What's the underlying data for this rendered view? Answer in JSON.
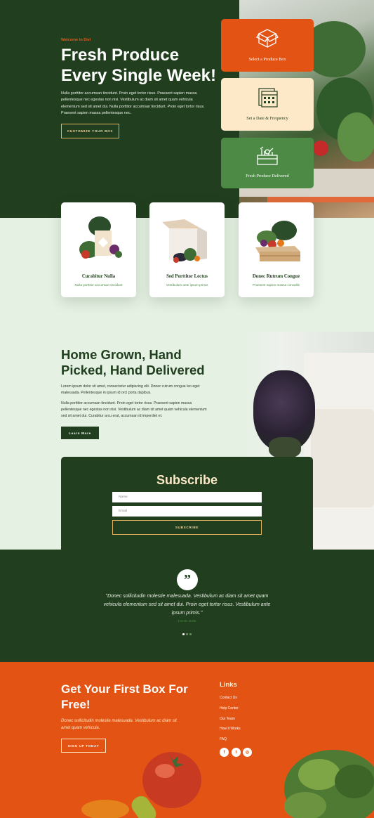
{
  "hero": {
    "eyebrow": "Welcome to Divi",
    "title": "Fresh Produce Every Single Week!",
    "text": "Nulla porttitor accumsan tincidunt. Proin eget tortor risus. Praesent sapien massa pellentesque nec egestas non nisi. Vestibulum ac diam sit amet quam vehicula elementum sed sit amet dui. Nulla porttitor accumsan tincidunt. Proin eget tortor risus. Praesent sapien massa pellentesque nec.",
    "button": "Customize Your Box"
  },
  "steps": [
    {
      "label": "Select a Produce Box",
      "icon": "box-icon"
    },
    {
      "label": "Set a Date & Frequency",
      "icon": "calendar-icon"
    },
    {
      "label": "Fresh Produce Delivered",
      "icon": "basket-icon"
    }
  ],
  "products": [
    {
      "name": "Curabitur Nulla",
      "desc": "Nulla porttitor accumsan tincidunt"
    },
    {
      "name": "Sed Porttitor Lectus",
      "desc": "Vestibulum ante ipsum primis"
    },
    {
      "name": "Donec Rutrum Congue",
      "desc": "Praesent sapien massa convallis"
    }
  ],
  "about": {
    "title": "Home Grown, Hand Picked, Hand Delivered",
    "p1": "Lorem ipsum dolor sit amet, consectetur adipiscing elit. Donec rutrum congue leo eget malesuada. Pellentesque in ipsum id orci porta dapibus.",
    "p2": "Nulla porttitor accumsan tincidunt. Proin eget tortor risus. Praesent sapien massa pellentesque nec egestas non nisi. Vestibulum ac diam sit amet quam vehicula elementum sed sit amet dui. Curabitur arcu erat, accumsan id imperdiet et.",
    "button": "Learn More"
  },
  "subscribe": {
    "title": "Subscribe",
    "name_placeholder": "Name",
    "email_placeholder": "Email",
    "button": "Subscribe"
  },
  "testimonial": {
    "quote_mark": "”",
    "text": "\"Donec sollicitudin molestie malesuada. Vestibulum ac diam sit amet quam vehicula elementum sed sit amet dui. Proin eget tortor risus. Vestibulum ante ipsum primis.\"",
    "author": "JOHN DOE"
  },
  "footer": {
    "title": "Get Your First Box For Free!",
    "text": "Donec sollicitudin molestie malesuada. Vestibulum ac diam sit amet quam vehicula.",
    "button": "Sign Up Today",
    "links_title": "Links",
    "links": [
      "Contact Us",
      "Help Center",
      "Our Team",
      "How It Works",
      "FAQ"
    ],
    "social": [
      {
        "icon": "facebook-icon",
        "glyph": "f"
      },
      {
        "icon": "twitter-icon",
        "glyph": "t"
      },
      {
        "icon": "instagram-icon",
        "glyph": "◎"
      }
    ]
  },
  "colors": {
    "dark_green": "#213f1e",
    "orange": "#e35414",
    "cream": "#fde8c8",
    "light_green": "#e5f1e3",
    "mid_green": "#4c8a46"
  }
}
